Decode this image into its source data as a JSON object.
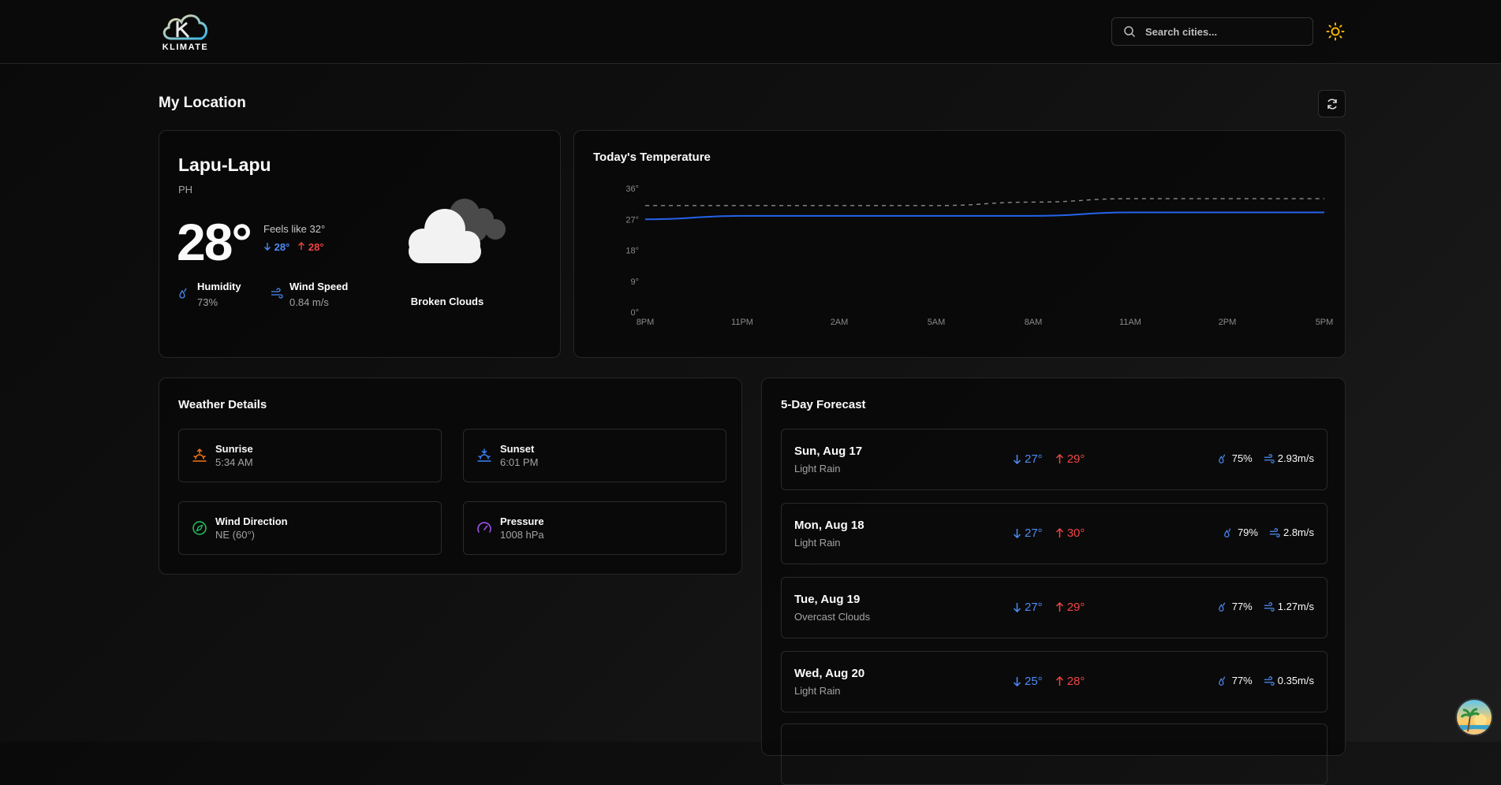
{
  "header": {
    "logo_text": "KLIMATE",
    "search_placeholder": "Search cities..."
  },
  "page": {
    "title": "My Location"
  },
  "current": {
    "city": "Lapu-Lapu",
    "country": "PH",
    "temp": "28°",
    "feels_like": "Feels like 32°",
    "min": "28°",
    "max": "28°",
    "humidity_label": "Humidity",
    "humidity_value": "73%",
    "wind_label": "Wind Speed",
    "wind_value": "0.84 m/s",
    "condition": "Broken Clouds"
  },
  "today_chart": {
    "title": "Today's Temperature",
    "y_ticks": [
      "36°",
      "27°",
      "18°",
      "9°",
      "0°"
    ],
    "x_ticks": [
      "8PM",
      "11PM",
      "2AM",
      "5AM",
      "8AM",
      "11AM",
      "2PM",
      "5PM"
    ]
  },
  "chart_data": {
    "type": "line",
    "title": "Today's Temperature",
    "x": [
      "8PM",
      "11PM",
      "2AM",
      "5AM",
      "8AM",
      "11AM",
      "2PM",
      "5PM"
    ],
    "ylim": [
      0,
      36
    ],
    "series": [
      {
        "values": [
          27,
          28,
          28,
          28,
          28,
          29,
          29,
          29
        ],
        "style": "solid",
        "color": "#2563eb"
      },
      {
        "values": [
          31,
          31,
          31,
          31,
          32,
          33,
          33,
          33
        ],
        "style": "dashed",
        "color": "#8a8a8a"
      }
    ],
    "grid": false
  },
  "details": {
    "title": "Weather Details",
    "items": [
      {
        "label": "Sunrise",
        "value": "5:34 AM"
      },
      {
        "label": "Sunset",
        "value": "6:01 PM"
      },
      {
        "label": "Wind Direction",
        "value": "NE (60°)"
      },
      {
        "label": "Pressure",
        "value": "1008 hPa"
      }
    ]
  },
  "forecast": {
    "title": "5-Day Forecast",
    "days": [
      {
        "day": "Sun, Aug 17",
        "desc": "Light Rain",
        "min": "27°",
        "max": "29°",
        "humidity": "75%",
        "wind": "2.93m/s"
      },
      {
        "day": "Mon, Aug 18",
        "desc": "Light Rain",
        "min": "27°",
        "max": "30°",
        "humidity": "79%",
        "wind": "2.8m/s"
      },
      {
        "day": "Tue, Aug 19",
        "desc": "Overcast Clouds",
        "min": "27°",
        "max": "29°",
        "humidity": "77%",
        "wind": "1.27m/s"
      },
      {
        "day": "Wed, Aug 20",
        "desc": "Light Rain",
        "min": "25°",
        "max": "28°",
        "humidity": "77%",
        "wind": "0.35m/s"
      }
    ]
  },
  "colors": {
    "accent_blue": "#4d8bf5",
    "accent_red": "#ef4444",
    "sun_yellow": "#f5b400"
  }
}
